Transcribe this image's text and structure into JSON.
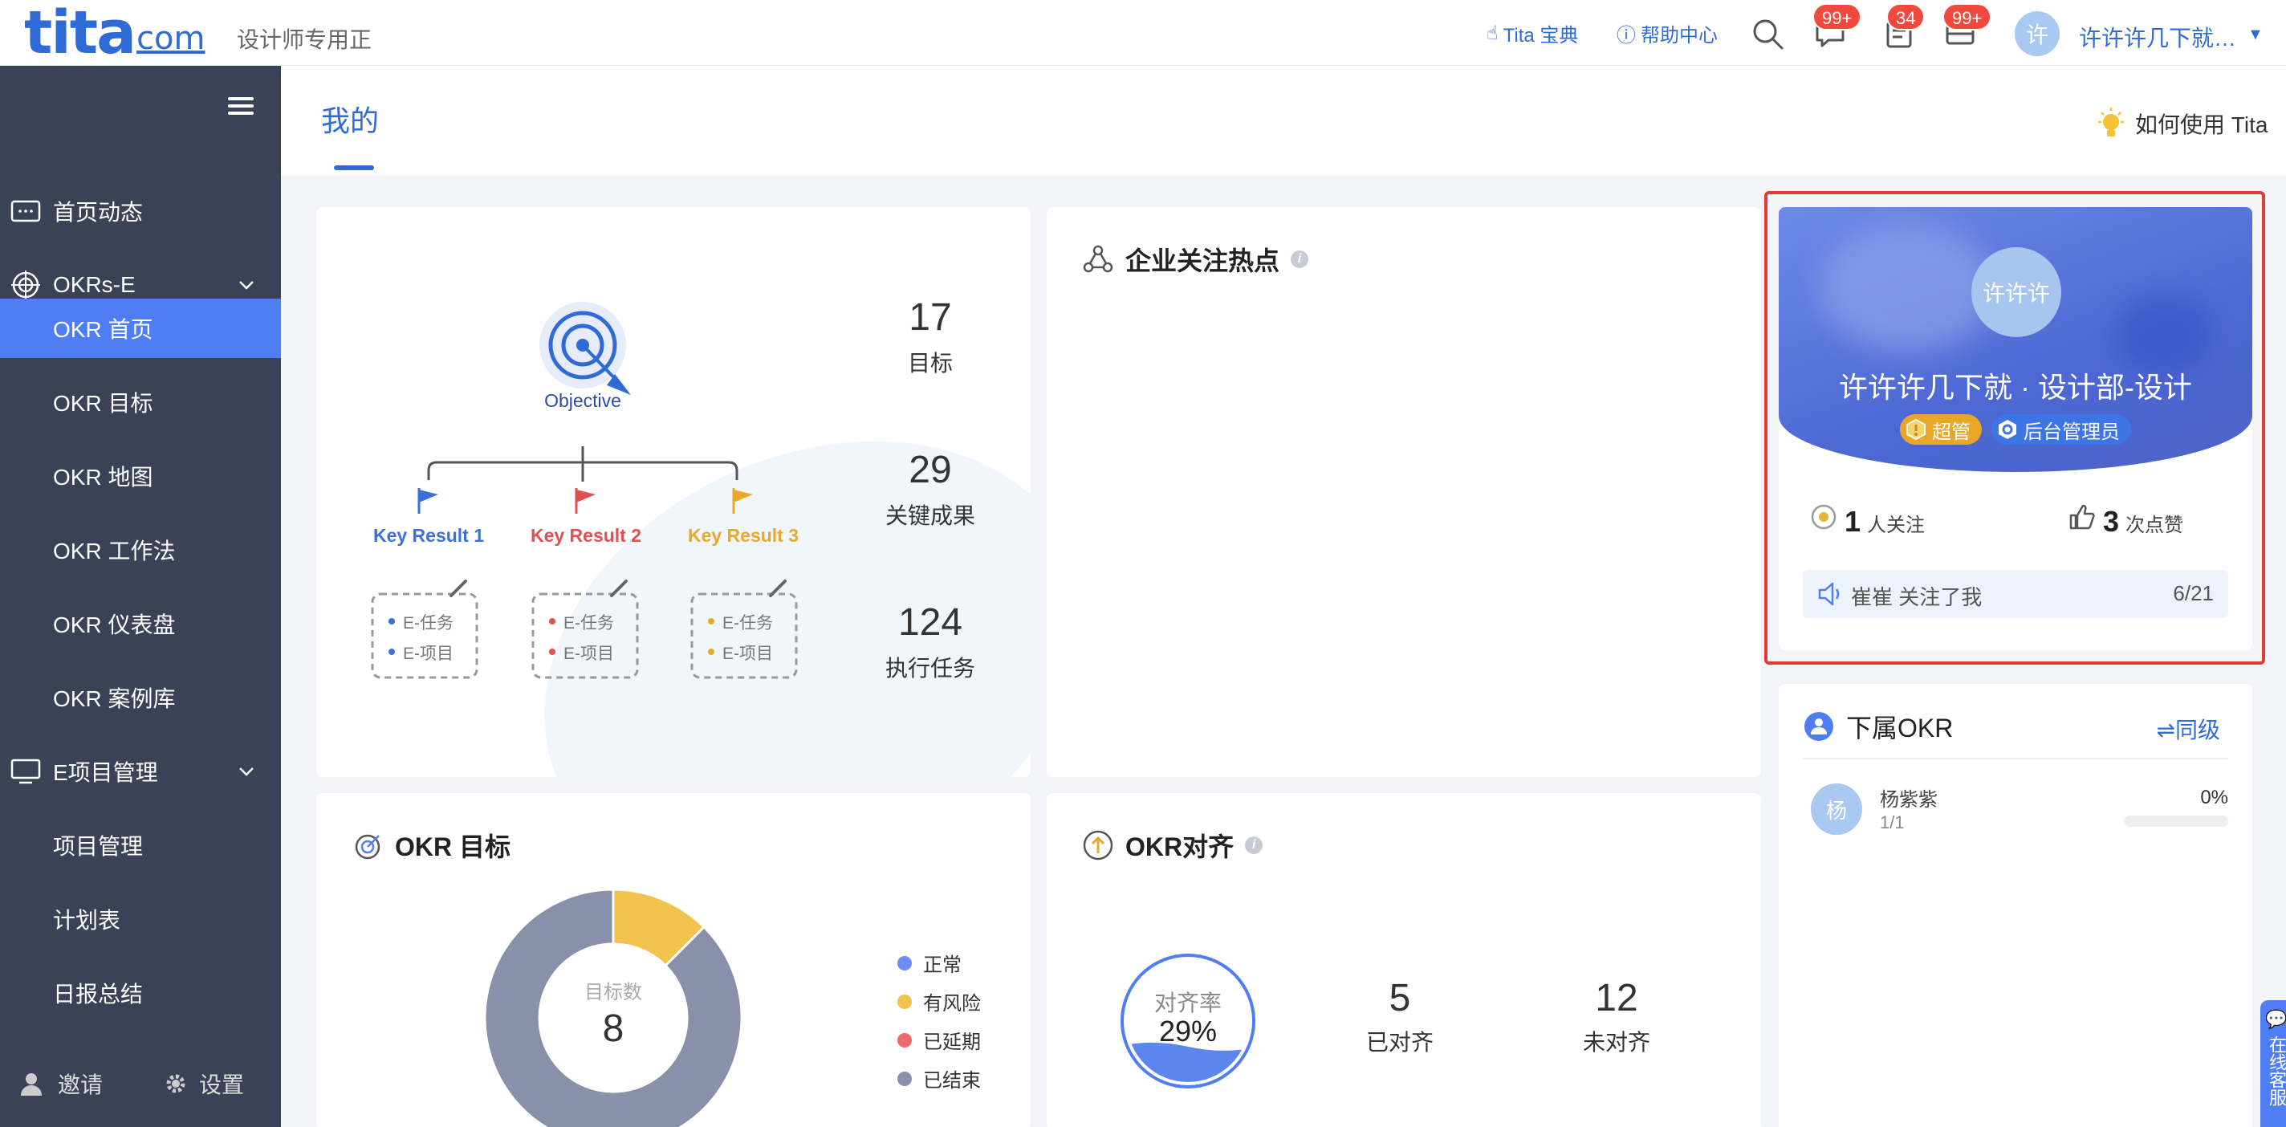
{
  "brand": {
    "logo_main": "tita",
    "logo_suffix": "com",
    "subtitle": "设计师专用正"
  },
  "topbar": {
    "links": [
      {
        "label": "Tita 宝典",
        "icon": "hand-icon"
      },
      {
        "label": "帮助中心",
        "icon": "help-icon"
      }
    ],
    "badges": {
      "messages": "99+",
      "tasks": "34",
      "notifications": "99+"
    },
    "user": {
      "avatar": "许",
      "name": "许许许几下就…"
    }
  },
  "sidebar": {
    "items": [
      {
        "label": "首页动态"
      },
      {
        "label": "OKRs-E"
      },
      {
        "label": "OKR 首页"
      },
      {
        "label": "OKR 目标"
      },
      {
        "label": "OKR 地图"
      },
      {
        "label": "OKR 工作法"
      },
      {
        "label": "OKR 仪表盘"
      },
      {
        "label": "OKR 案例库"
      },
      {
        "label": "E项目管理"
      },
      {
        "label": "项目管理"
      },
      {
        "label": "计划表"
      },
      {
        "label": "日报总结"
      }
    ],
    "footer": {
      "invite": "邀请",
      "settings": "设置"
    }
  },
  "page": {
    "tab": "我的",
    "how_to": "如何使用 Tita"
  },
  "summary": {
    "objective_label": "Objective",
    "key_results": [
      {
        "label": "Key Result 1",
        "color": "#3d6fd8"
      },
      {
        "label": "Key Result 2",
        "color": "#e05050"
      },
      {
        "label": "Key Result 3",
        "color": "#e8a92a"
      }
    ],
    "box_items": [
      "E-任务",
      "E-项目"
    ],
    "stats": [
      {
        "num": "17",
        "label": "目标"
      },
      {
        "num": "29",
        "label": "关键成果"
      },
      {
        "num": "124",
        "label": "执行任务"
      }
    ]
  },
  "hot": {
    "title": "企业关注热点"
  },
  "profile": {
    "avatar": "许许许",
    "name": "许许许几下就 · 设计部-设计",
    "tags": [
      "超管",
      "后台管理员"
    ],
    "followers": {
      "num": "1",
      "label": "人关注"
    },
    "likes": {
      "num": "3",
      "label": "次点赞"
    },
    "notice": {
      "text": "崔崔 关注了我",
      "count": "6/21"
    }
  },
  "subordinate": {
    "title": "下属OKR",
    "switch_label": "⇌同级",
    "rows": [
      {
        "avatar": "杨",
        "name": "杨紫紫",
        "count": "1/1",
        "percent": "0%",
        "progress": 0
      }
    ]
  },
  "target": {
    "title": "OKR 目标",
    "center_label": "目标数",
    "center_value": "8",
    "legend": [
      {
        "label": "正常",
        "color": "#6b8ff0"
      },
      {
        "label": "有风险",
        "color": "#f2c24f"
      },
      {
        "label": "已延期",
        "color": "#ec6a6a"
      },
      {
        "label": "已结束",
        "color": "#8891a9"
      }
    ]
  },
  "chart_data": {
    "type": "pie",
    "title": "OKR 目标",
    "categories": [
      "正常",
      "有风险",
      "已延期",
      "已结束"
    ],
    "values": [
      0,
      1,
      0,
      7
    ]
  },
  "align": {
    "title": "OKR对齐",
    "rate_label": "对齐率",
    "rate_value": "29%",
    "rate": 0.29,
    "aligned": {
      "num": "5",
      "label": "已对齐"
    },
    "unaligned": {
      "num": "12",
      "label": "未对齐"
    }
  },
  "service": {
    "label": "在线客服"
  },
  "colors": {
    "primary": "#2f6bd6",
    "sidebar": "#3b4257",
    "active": "#4f7ef4",
    "highlight": "#e53935"
  }
}
